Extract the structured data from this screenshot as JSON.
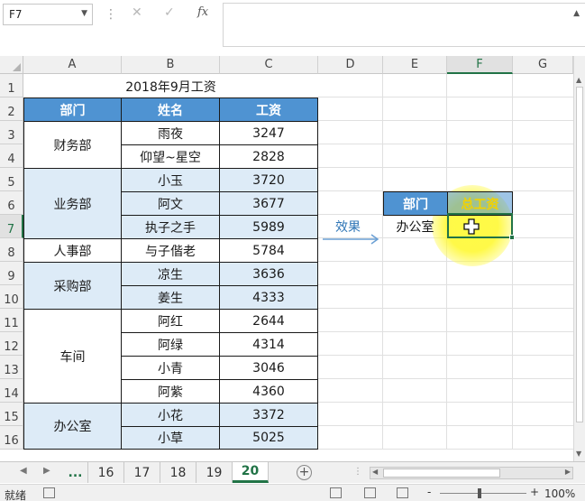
{
  "formula_bar": {
    "name_box": "F7",
    "fx_label": "fx",
    "cancel_glyph": "✕",
    "enter_glyph": "✓",
    "content": ""
  },
  "columns": [
    "A",
    "B",
    "C",
    "D",
    "E",
    "F",
    "G"
  ],
  "rows": [
    "1",
    "2",
    "3",
    "4",
    "5",
    "6",
    "7",
    "8",
    "9",
    "10",
    "11",
    "12",
    "13",
    "14",
    "15",
    "16"
  ],
  "sheet_title": "2018年9月工资",
  "table_headers": {
    "dept": "部门",
    "name": "姓名",
    "salary": "工资"
  },
  "departments": [
    "财务部",
    "业务部",
    "人事部",
    "采购部",
    "车间",
    "办公室"
  ],
  "employees": [
    {
      "name": "雨夜",
      "salary": "3247"
    },
    {
      "name": "仰望~星空",
      "salary": "2828"
    },
    {
      "name": "小玉",
      "salary": "3720"
    },
    {
      "name": "阿文",
      "salary": "3677"
    },
    {
      "name": "执子之手",
      "salary": "5989"
    },
    {
      "name": "与子偕老",
      "salary": "5784"
    },
    {
      "name": "凉生",
      "salary": "3636"
    },
    {
      "name": "姜生",
      "salary": "4333"
    },
    {
      "name": "阿红",
      "salary": "2644"
    },
    {
      "name": "阿绿",
      "salary": "4314"
    },
    {
      "name": "小青",
      "salary": "3046"
    },
    {
      "name": "阿紫",
      "salary": "4360"
    },
    {
      "name": "小花",
      "salary": "3372"
    },
    {
      "name": "小草",
      "salary": "5025"
    }
  ],
  "lookup_table": {
    "header_dept": "部门",
    "header_total": "总工资",
    "value_dept": "办公室",
    "value_total": ""
  },
  "effect_label": "效果",
  "sheet_tabs": {
    "more": "...",
    "tabs": [
      "16",
      "17",
      "18",
      "19",
      "20"
    ],
    "active": "20"
  },
  "status_bar": {
    "ready": "就绪",
    "zoom": "100%",
    "zoom_minus": "-",
    "zoom_plus": "+"
  },
  "colors": {
    "header_blue": "#4f93d2",
    "light_blue": "#ddebf7",
    "excel_green": "#217346",
    "highlight_yellow": "#fff83c",
    "total_header_text": "#f2d200"
  }
}
